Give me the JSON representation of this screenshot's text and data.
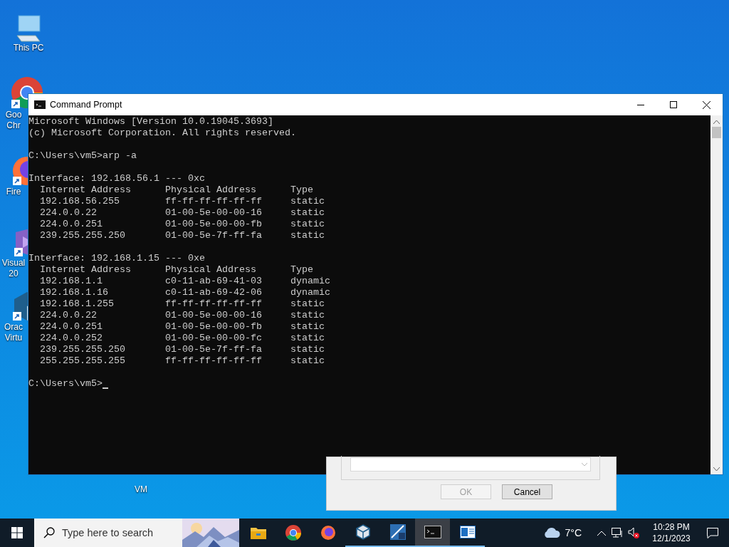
{
  "desktop_icons": [
    {
      "kind": "pc",
      "label": [
        "This PC"
      ]
    },
    {
      "kind": "chrome",
      "label": [
        "Goo",
        "Chr"
      ]
    },
    {
      "kind": "firefox",
      "label": [
        "Fire"
      ]
    },
    {
      "kind": "vs",
      "label": [
        "Visual",
        "20"
      ]
    },
    {
      "kind": "vbox",
      "label": [
        "Orac",
        "Virtu"
      ]
    },
    {
      "kind": "hidden",
      "label": [
        "VM"
      ]
    }
  ],
  "console_window": {
    "title": "Command Prompt",
    "blocks": [
      [
        "Microsoft Windows [Version 10.0.19045.3693]",
        "(c) Microsoft Corporation. All rights reserved."
      ],
      [
        "C:\\Users\\vm5>arp -a"
      ],
      [
        "Interface: 192.168.56.1 --- 0xc",
        "  Internet Address      Physical Address      Type",
        "  192.168.56.255        ff-ff-ff-ff-ff-ff     static",
        "  224.0.0.22            01-00-5e-00-00-16     static",
        "  224.0.0.251           01-00-5e-00-00-fb     static",
        "  239.255.255.250       01-00-5e-7f-ff-fa     static"
      ],
      [
        "Interface: 192.168.1.15 --- 0xe",
        "  Internet Address      Physical Address      Type",
        "  192.168.1.1           c0-11-ab-69-41-03     dynamic",
        "  192.168.1.16          c0-11-ab-69-42-06     dynamic",
        "  192.168.1.255         ff-ff-ff-ff-ff-ff     static",
        "  224.0.0.22            01-00-5e-00-00-16     static",
        "  224.0.0.251           01-00-5e-00-00-fb     static",
        "  224.0.0.252           01-00-5e-00-00-fc     static",
        "  239.255.255.250       01-00-5e-7f-ff-fa     static",
        "  255.255.255.255       ff-ff-ff-ff-ff-ff     static"
      ],
      [
        "C:\\Users\\vm5>"
      ]
    ]
  },
  "dialog": {
    "buttons": [
      {
        "label": "OK",
        "disabled": true
      },
      {
        "label": "Cancel",
        "disabled": false
      }
    ]
  },
  "taskbar": {
    "search": {
      "placeholder": "Type here to search"
    },
    "apps": [
      {
        "kind": "explorer",
        "running": false,
        "selected": false
      },
      {
        "kind": "chrome",
        "running": false,
        "selected": false
      },
      {
        "kind": "firefox",
        "running": false,
        "selected": false
      },
      {
        "kind": "vbox",
        "running": true,
        "selected": false
      },
      {
        "kind": "tool",
        "running": true,
        "selected": false
      },
      {
        "kind": "cmd",
        "running": true,
        "selected": true
      },
      {
        "kind": "window",
        "running": true,
        "selected": false
      }
    ],
    "weather": "7°C",
    "time": "10:28 PM",
    "date": "12/1/2023"
  }
}
